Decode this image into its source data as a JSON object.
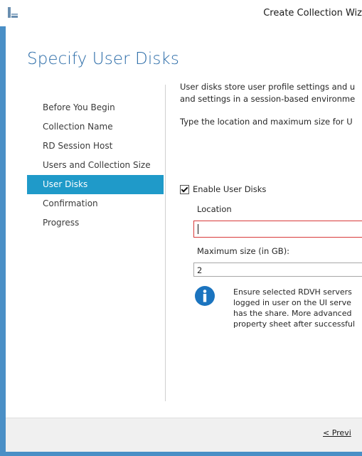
{
  "window": {
    "title": "Create Collection Wiz",
    "app_icon": "server-manager-icon"
  },
  "page": {
    "heading": "Specify User Disks"
  },
  "nav": {
    "items": [
      {
        "label": "Before You Begin",
        "active": false
      },
      {
        "label": "Collection Name",
        "active": false
      },
      {
        "label": "RD Session Host",
        "active": false
      },
      {
        "label": "Users and Collection Size",
        "active": false
      },
      {
        "label": "User Disks",
        "active": true
      },
      {
        "label": "Confirmation",
        "active": false
      },
      {
        "label": "Progress",
        "active": false
      }
    ]
  },
  "content": {
    "description_line1": "User disks store user profile settings and u",
    "description_line2": "and settings in a session-based environme",
    "instruction": "Type the location and maximum size for U",
    "enable_checkbox": {
      "label": "Enable User Disks",
      "checked": true
    },
    "location": {
      "label": "Location",
      "value": ""
    },
    "max_size": {
      "label": "Maximum size (in GB):",
      "value": "2"
    },
    "info": {
      "icon": "info-icon",
      "lines": [
        "Ensure selected RDVH servers",
        "logged in user on the UI serve",
        "has the share. More advanced",
        "property sheet after successful"
      ]
    }
  },
  "footer": {
    "previous_label": "< Previ"
  },
  "colors": {
    "accent": "#1f9ac9",
    "heading": "#2b6ca8",
    "frame": "#4a8fc6",
    "error_border": "#d83a3a",
    "info_icon": "#1b74bf"
  }
}
